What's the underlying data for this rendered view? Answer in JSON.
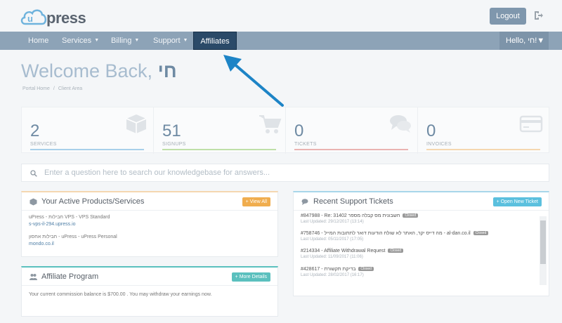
{
  "brand": {
    "logo_text": "press"
  },
  "header": {
    "logout_label": "Logout"
  },
  "nav": {
    "items": [
      {
        "label": "Home"
      },
      {
        "label": "Services"
      },
      {
        "label": "Billing"
      },
      {
        "label": "Support"
      },
      {
        "label": "Affiliates"
      }
    ],
    "hello_label": "Hello, חי!"
  },
  "page": {
    "welcome_prefix": "Welcome Back,",
    "welcome_name": "חי",
    "breadcrumb": [
      "Portal Home",
      "Client Area"
    ]
  },
  "stats": [
    {
      "value": "2",
      "label": "SERVICES",
      "color": "#5aa9d6",
      "icon": "cube-icon"
    },
    {
      "value": "51",
      "label": "SIGNUPS",
      "color": "#7cc24f",
      "icon": "cart-icon"
    },
    {
      "value": "0",
      "label": "TICKETS",
      "color": "#d9534f",
      "icon": "comments-icon"
    },
    {
      "value": "0",
      "label": "INVOICES",
      "color": "#f0ad4e",
      "icon": "credit-card-icon"
    }
  ],
  "search": {
    "placeholder": "Enter a question here to search our knowledgebase for answers..."
  },
  "products_panel": {
    "title": "Your Active Products/Services",
    "button_label": "View All",
    "items": [
      {
        "name": "uPress - חבילות VPS - VPS Standard",
        "domain": "s-vps-il-294.upress.io"
      },
      {
        "name": "חבילות אחסון - uPress - uPress Personal",
        "domain": "mondo.co.il"
      }
    ]
  },
  "affiliate_panel": {
    "title": "Affiliate Program",
    "button_label": "More Details",
    "text": "Your current commission balance is $700.00 . You may withdraw your earnings now."
  },
  "tickets_panel": {
    "title": "Recent Support Tickets",
    "button_label": "Open New Ticket",
    "items": [
      {
        "title": "#847988 - Re: 31402 חשבונית מס קבלה מספר",
        "status": "Closed",
        "updated": "Last Updated: 29/12/2017 (13:14)"
      },
      {
        "title": "#758746 - מה דייס יקר, האתר לא שולח הודעות דואר לתתובות המייל - al-dan.co.il",
        "status": "Closed",
        "updated": "Last Updated: 05/11/2017 (17:05)"
      },
      {
        "title": "#214334 - Affiliate Withdrawal Request",
        "status": "Closed",
        "updated": "Last Updated: 11/09/2017 (11:06)"
      },
      {
        "title": "#428617 - בדיקת תקשורת",
        "status": "Closed",
        "updated": "Last Updated: 28/02/2017 (16:17)"
      }
    ]
  },
  "colors": {
    "navbar": "#8da3b7",
    "nav_active": "#2b4a68",
    "arrow": "#1d84c6",
    "view_all_btn": "#f0ad4e",
    "more_details_btn": "#5bc0be",
    "open_ticket_btn": "#5bc0de"
  }
}
